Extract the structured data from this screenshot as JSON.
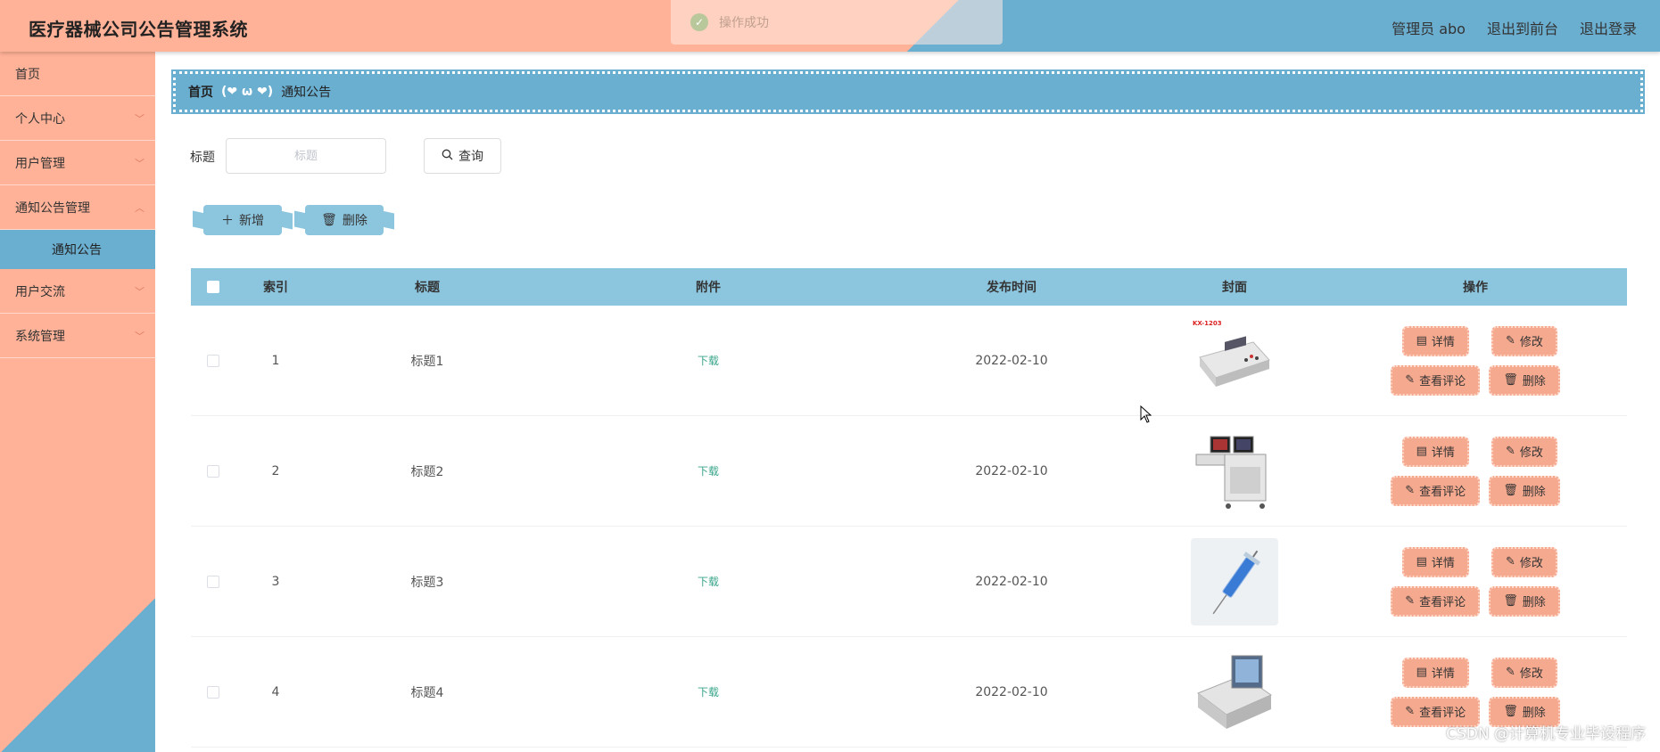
{
  "app": {
    "title": "医疗器械公司公告管理系统",
    "user": "管理员 abo",
    "to_frontend": "退出到前台",
    "logout": "退出登录"
  },
  "toast": {
    "message": "操作成功",
    "icon": "check-circle-icon"
  },
  "sidebar": {
    "items": [
      {
        "label": "首页"
      },
      {
        "label": "个人中心"
      },
      {
        "label": "用户管理"
      },
      {
        "label": "通知公告管理"
      },
      {
        "label": "通知公告"
      },
      {
        "label": "用户交流"
      },
      {
        "label": "系统管理"
      }
    ]
  },
  "breadcrumb": {
    "home": "首页",
    "separator": "(❤ ω ❤)",
    "current": "通知公告"
  },
  "search": {
    "label": "标题",
    "placeholder": "标题",
    "value": "",
    "button": "查询"
  },
  "actions": {
    "add": "新增",
    "delete": "删除"
  },
  "table": {
    "headers": [
      "索引",
      "标题",
      "附件",
      "发布时间",
      "封面",
      "操作"
    ],
    "rows": [
      {
        "index": "1",
        "title": "标题1",
        "attachment": "下载",
        "date": "2022-02-10",
        "cover_label": "KX-1203"
      },
      {
        "index": "2",
        "title": "标题2",
        "attachment": "下载",
        "date": "2022-02-10",
        "cover_label": ""
      },
      {
        "index": "3",
        "title": "标题3",
        "attachment": "下载",
        "date": "2022-02-10",
        "cover_label": ""
      },
      {
        "index": "4",
        "title": "标题4",
        "attachment": "下载",
        "date": "2022-02-10",
        "cover_label": ""
      }
    ],
    "ops": {
      "detail": "详情",
      "edit": "修改",
      "comments": "查看评论",
      "delete": "删除"
    }
  },
  "watermark": "CSDN @计算机专业毕设程序",
  "colors": {
    "salmon": "#ffb297",
    "blue": "#6aaed0",
    "light_blue": "#8cc5de",
    "button_salmon": "#f5a98f",
    "link_green": "#3aa58a"
  }
}
